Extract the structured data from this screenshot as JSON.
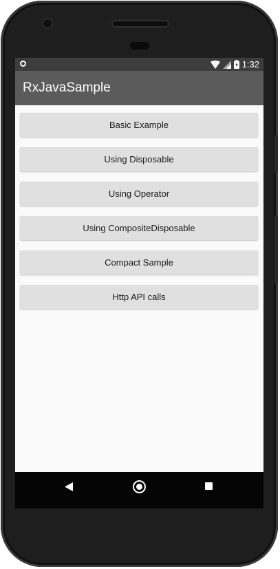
{
  "status_bar": {
    "time": "1:32",
    "icons": [
      "circle-notification-icon",
      "wifi-icon",
      "signal-icon",
      "battery-icon"
    ]
  },
  "app_bar": {
    "title": "RxJavaSample"
  },
  "buttons": [
    {
      "label": "Basic Example"
    },
    {
      "label": "Using Disposable"
    },
    {
      "label": "Using Operator"
    },
    {
      "label": "Using CompositeDisposable"
    },
    {
      "label": "Compact Sample"
    },
    {
      "label": "Http API calls"
    }
  ],
  "nav_bar": {
    "icons": [
      "back-icon",
      "home-icon",
      "recents-icon"
    ]
  },
  "colors": {
    "app_bar": "#5b5b5b",
    "status_bar": "#3d3d3d",
    "button": "#e0e0e0",
    "background": "#fafafa"
  }
}
